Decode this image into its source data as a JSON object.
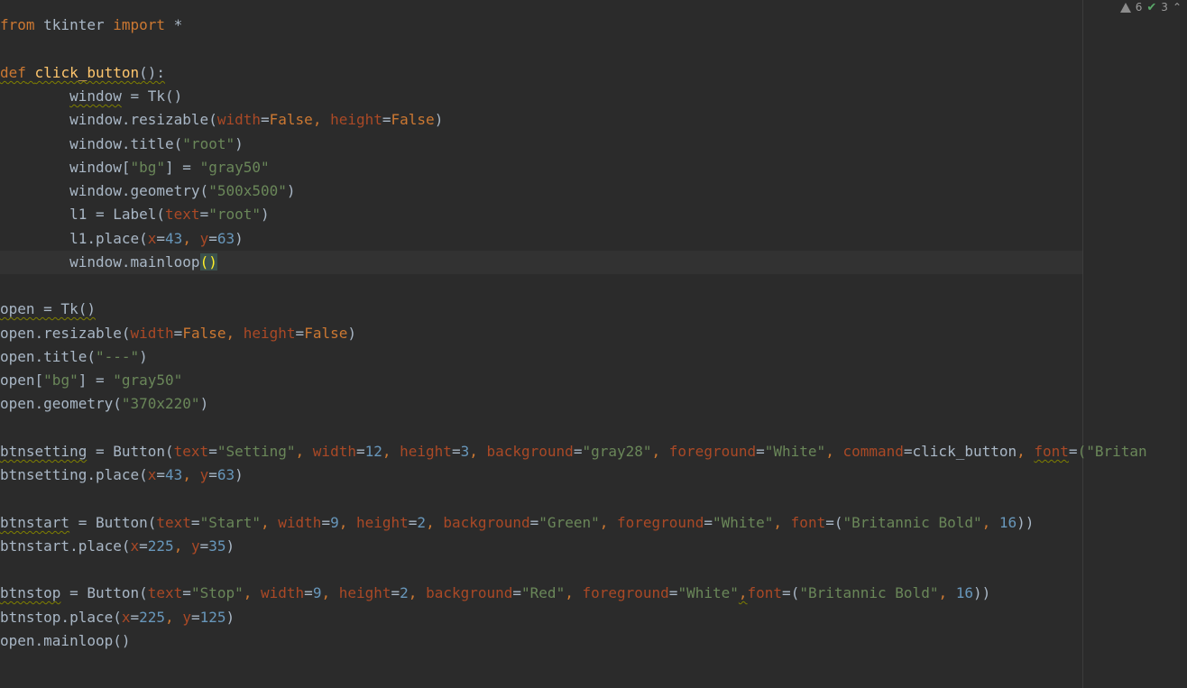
{
  "inspection": {
    "warnings_count": "6",
    "weak_warnings_count": "3",
    "warn_icon": "warning-triangle-icon",
    "check_icon": "check-icon",
    "chevron_icon": "chevron-up-icon"
  },
  "code": {
    "l1_kw_from": "from",
    "l1_mod": " tkinter ",
    "l1_kw_import": "import",
    "l1_star": " *",
    "l3_kw_def": "def",
    "l3_fn": "click_button",
    "l3_paren": "():",
    "l4_indent": "        ",
    "l4_var": "window",
    "l4_rest": " = Tk()",
    "l5_a": "window.resizable(",
    "l5_p1": "width",
    "l5_eq1": "=",
    "l5_v1": "False",
    "l5_sep": ", ",
    "l5_p2": "height",
    "l5_eq2": "=",
    "l5_v2": "False",
    "l5_end": ")",
    "l6_a": "window.title(",
    "l6_s": "\"root\"",
    "l6_end": ")",
    "l7_a": "window[",
    "l7_s1": "\"bg\"",
    "l7_b": "] = ",
    "l7_s2": "\"gray50\"",
    "l8_a": "window.geometry(",
    "l8_s": "\"500x500\"",
    "l8_end": ")",
    "l9_a": "l1 = Label(",
    "l9_p": "text",
    "l9_eq": "=",
    "l9_s": "\"root\"",
    "l9_end": ")",
    "l10_a": "l1.place(",
    "l10_p1": "x",
    "l10_eq1": "=",
    "l10_n1": "43",
    "l10_sep": ", ",
    "l10_p2": "y",
    "l10_eq2": "=",
    "l10_n2": "63",
    "l10_end": ")",
    "l11_a": "window.mainloop",
    "l11_b": "()",
    "l13_a": "open = Tk()",
    "l14_a": "open.resizable(",
    "l14_p1": "width",
    "l14_eq1": "=",
    "l14_v1": "False",
    "l14_sep": ", ",
    "l14_p2": "height",
    "l14_eq2": "=",
    "l14_v2": "False",
    "l14_end": ")",
    "l15_a": "open.title(",
    "l15_s": "\"---\"",
    "l15_end": ")",
    "l16_a": "open[",
    "l16_s1": "\"bg\"",
    "l16_b": "] = ",
    "l16_s2": "\"gray50\"",
    "l17_a": "open.geometry(",
    "l17_s": "\"370x220\"",
    "l17_end": ")",
    "l19_var": "btnsetting",
    "l19_a": " = Button(",
    "l19_p1": "text",
    "l19_eq": "=",
    "l19_s1": "\"Setting\"",
    "l19_sep": ", ",
    "l19_p2": "width",
    "l19_n1": "12",
    "l19_p3": "height",
    "l19_n2": "3",
    "l19_p4": "background",
    "l19_s2": "\"gray28\"",
    "l19_p5": "foreground",
    "l19_s3": "\"White\"",
    "l19_p6": "command",
    "l19_v": "click_button",
    "l19_p7": "font",
    "l19_s4": "(\"Britan",
    "l20_a": "btnsetting.place(",
    "l20_p1": "x",
    "l20_n1": "43",
    "l20_p2": "y",
    "l20_n2": "63",
    "l20_end": ")",
    "l22_var": "btnstart",
    "l22_a": " = Button(",
    "l22_p1": "text",
    "l22_s1": "\"Start\"",
    "l22_p2": "width",
    "l22_n1": "9",
    "l22_p3": "height",
    "l22_n2": "2",
    "l22_p4": "background",
    "l22_s2": "\"Green\"",
    "l22_p5": "foreground",
    "l22_s3": "\"White\"",
    "l22_p6": "font",
    "l22_s4": "\"Britannic Bold\"",
    "l22_n3": "16",
    "l22_end": "))",
    "l23_a": "btnstart.place(",
    "l23_p1": "x",
    "l23_n1": "225",
    "l23_p2": "y",
    "l23_n2": "35",
    "l23_end": ")",
    "l25_var": "btnstop",
    "l25_a": " = Button(",
    "l25_p1": "text",
    "l25_s1": "\"Stop\"",
    "l25_p2": "width",
    "l25_n1": "9",
    "l25_p3": "height",
    "l25_n2": "2",
    "l25_p4": "background",
    "l25_s2": "\"Red\"",
    "l25_p5": "foreground",
    "l25_s3": "\"White\"",
    "l25_sep2": ",",
    "l25_p6": "font",
    "l25_s4": "\"Britannic Bold\"",
    "l25_n3": "16",
    "l25_end": "))",
    "l26_a": "btnstop.place(",
    "l26_p1": "x",
    "l26_n1": "225",
    "l26_p2": "y",
    "l26_n2": "125",
    "l26_end": ")",
    "l27_a": "open.mainloop()"
  },
  "colors": {
    "background": "#2b2b2b",
    "keyword": "#cc7832",
    "string": "#6a8759",
    "number": "#6897bb",
    "parameter": "#aa4926",
    "function": "#ffc66d",
    "text": "#a9b7c6"
  }
}
